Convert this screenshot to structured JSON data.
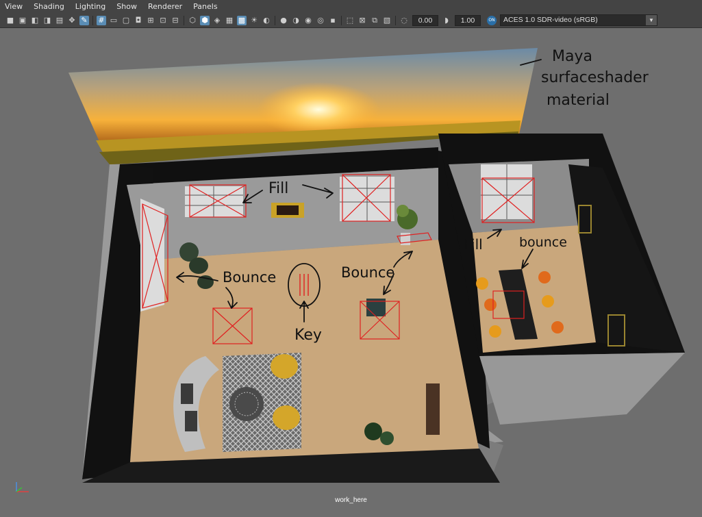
{
  "menu": [
    "View",
    "Shading",
    "Lighting",
    "Show",
    "Renderer",
    "Panels"
  ],
  "toolbar": {
    "exposure": "0.00",
    "gamma": "1.00",
    "toggle_label": "ON",
    "color_space": "ACES 1.0 SDR-video (sRGB)"
  },
  "annotations": {
    "note_line1": "Maya",
    "note_line2": "surfaceshader",
    "note_line3": "material",
    "fill_main": "Fill",
    "bounce_left": "Bounce",
    "bounce_right": "Bounce",
    "key": "Key",
    "fill_side": "Fill",
    "bounce_side": "bounce"
  },
  "camera_name": "work_here",
  "colors": {
    "annotation_ink": "#111111",
    "light_gizmo": "#e02020",
    "floor": "#c9a77c",
    "ui_panel": "#444444"
  }
}
